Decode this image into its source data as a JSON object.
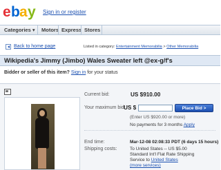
{
  "header": {
    "logo_letters": [
      "e",
      "b",
      "a",
      "y"
    ],
    "logo_colors": [
      "#e53238",
      "#0064d2",
      "#f5af02",
      "#86b817"
    ],
    "signin_text": "Sign in or register"
  },
  "nav": {
    "items": [
      "Categories",
      "Motors",
      "Express",
      "Stores"
    ],
    "categories_caret": "▾"
  },
  "breadcrumb": {
    "back_label": "Back to home page",
    "listed_prefix": "Listed in category: ",
    "category_1": "Entertainment Memorabilia",
    "separator": " > ",
    "category_2": "Other Memorabilia"
  },
  "item": {
    "title": "Wikipedia's Jimmy (Jimbo) Wales Sweater left @ex-g/f's"
  },
  "bidder_bar": {
    "question": "Bidder or seller of this item?",
    "signin_link": "Sign in",
    "suffix": " for your status"
  },
  "bid": {
    "current_bid_label": "Current bid:",
    "current_bid_value": "US $910.00",
    "max_bid_label": "Your maximum bid:",
    "currency": "US $",
    "max_bid_value": "",
    "place_bid_label": "Place Bid >",
    "hint": "(Enter US $920.00 or more)",
    "payments_text": "No payments for 3 months ",
    "apply_label": "Apply"
  },
  "end": {
    "label": "End time:",
    "value": "Mar-12-08 02:08:33 PDT (6 days 15 hours)"
  },
  "shipping": {
    "label": "Shipping costs:",
    "line1": "To United States -- US $5.00",
    "line2_prefix": "Standard Int'l Flat Rate Shipping",
    "line3_prefix": "Service to ",
    "line3_link": "United States",
    "more_services": "(more services)"
  }
}
